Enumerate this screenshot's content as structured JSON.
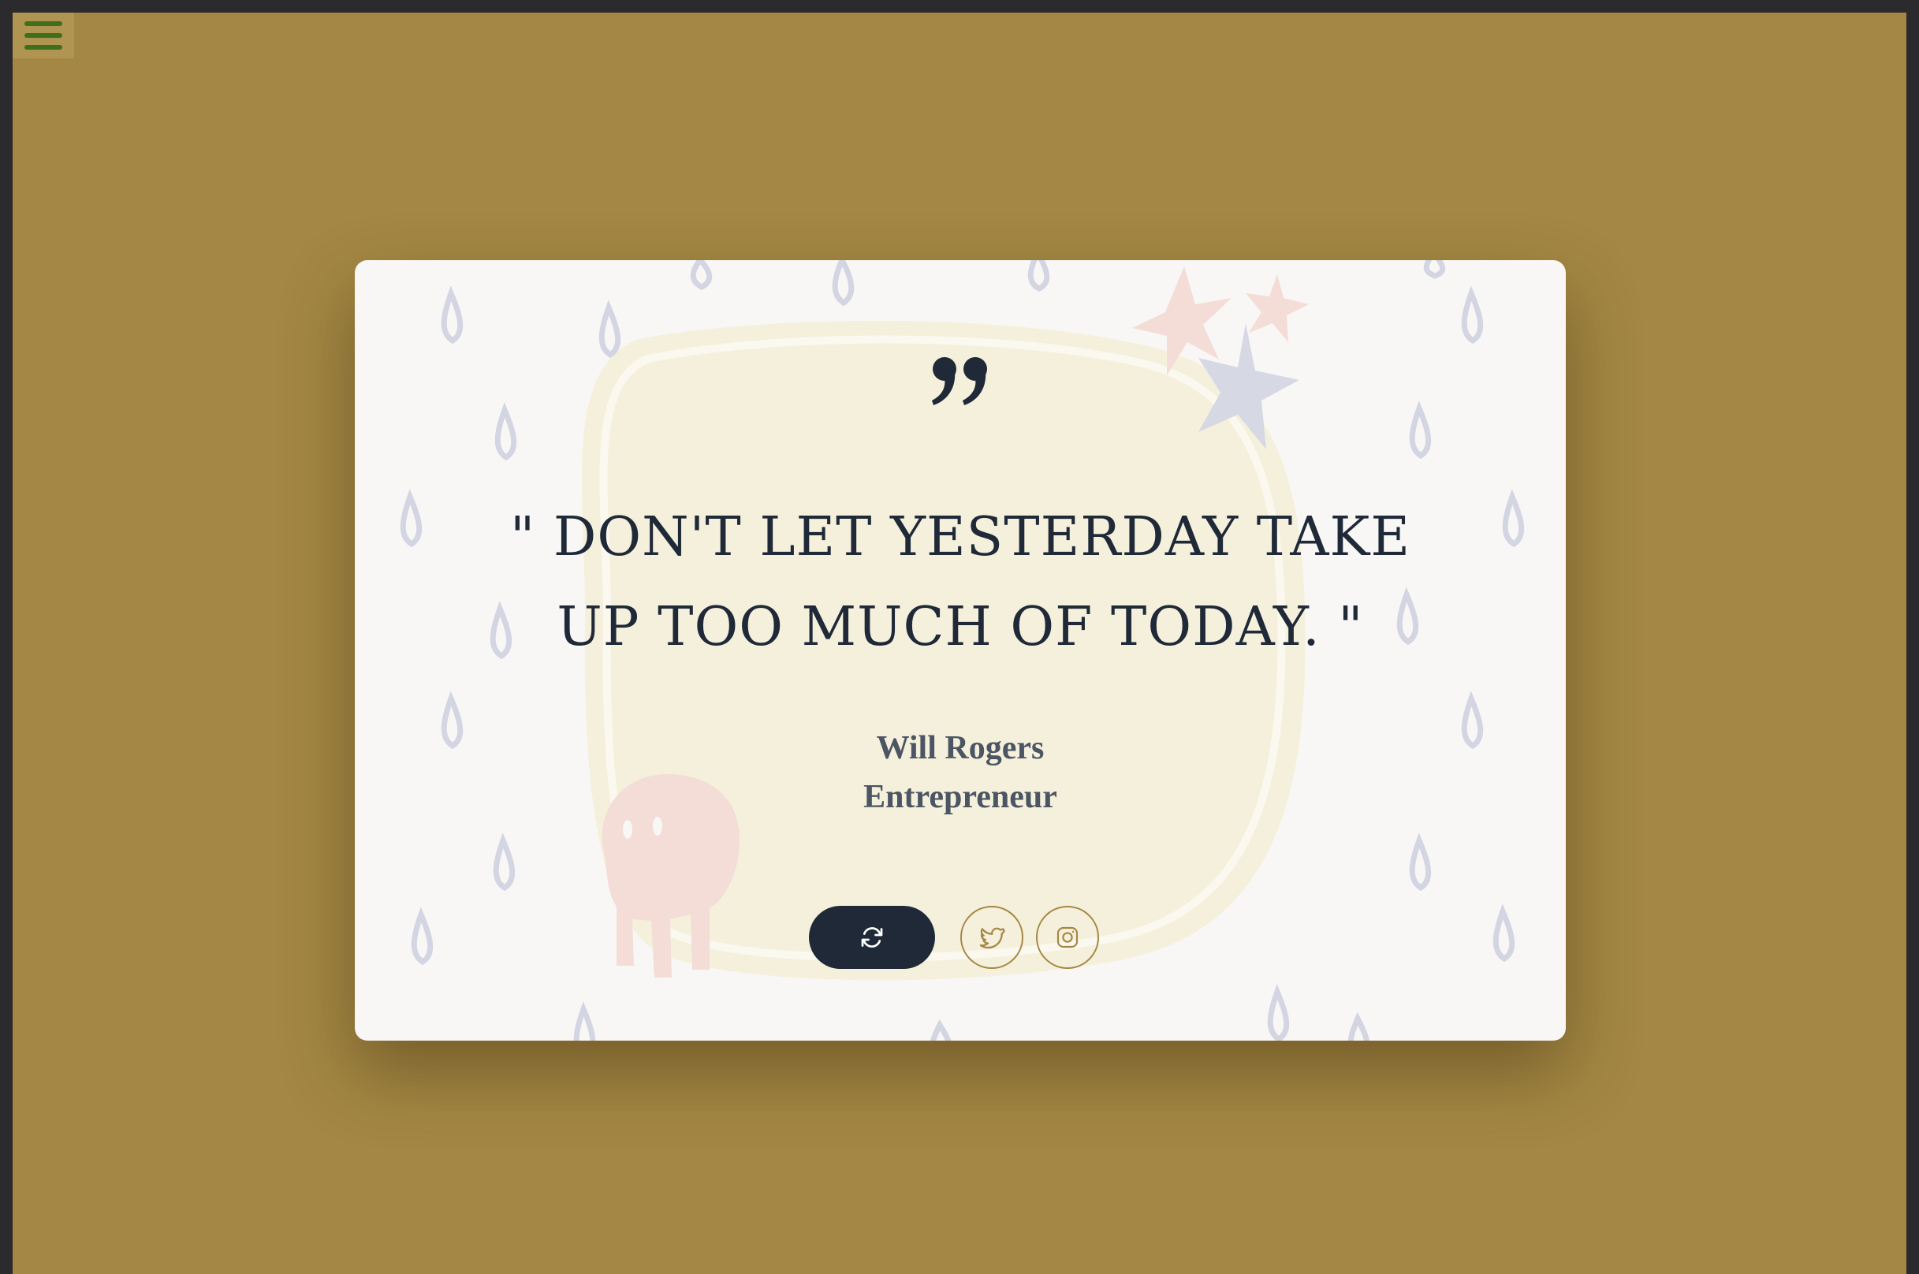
{
  "menu": {
    "icon": "hamburger-menu-icon"
  },
  "quote": {
    "mark_icon": "closing-quote-icon",
    "text": "\" DON'T LET YESTERDAY TAKE UP TOO MUCH OF TODAY. \"",
    "author": "Will Rogers",
    "role": "Entrepreneur"
  },
  "actions": {
    "new_quote_icon": "refresh-icon",
    "twitter_icon": "twitter-icon",
    "instagram_icon": "instagram-icon"
  },
  "colors": {
    "page_background": "#a48744",
    "card_background": "#f8f7f5",
    "text_dark": "#1f2937",
    "text_muted": "#4b5563",
    "accent": "#a48744",
    "menu_icon": "#3f6f1a"
  }
}
